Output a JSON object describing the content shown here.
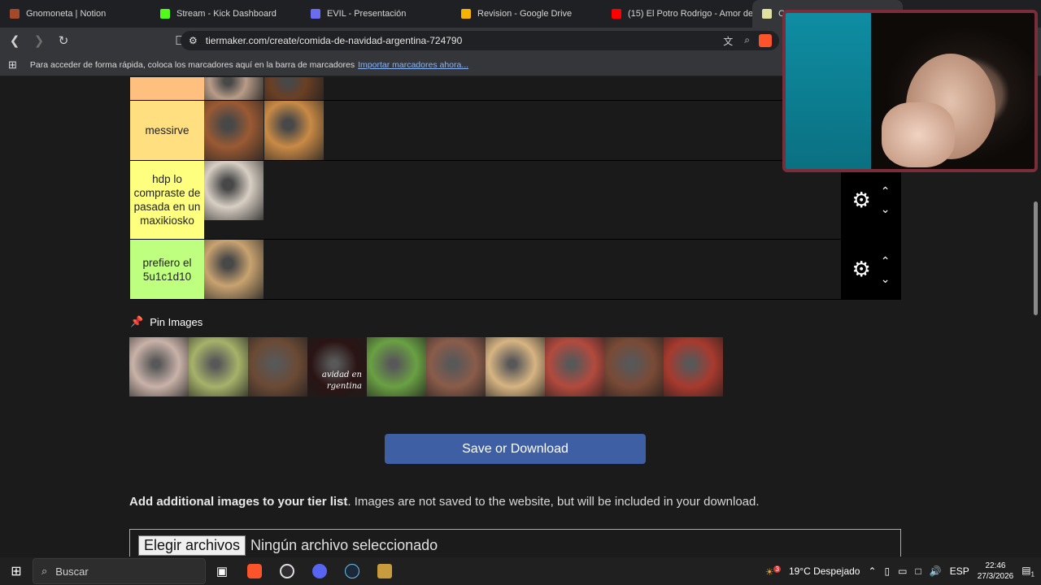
{
  "tabs": [
    {
      "label": "Gnomoneta | Notion",
      "color": "#a44a2a"
    },
    {
      "label": "Stream - Kick Dashboard",
      "color": "#53fc18"
    },
    {
      "label": "EVIL - Presentación",
      "color": "#6c6cf0"
    },
    {
      "label": "Revision - Google Drive",
      "color": "#f4b400"
    },
    {
      "label": "(15) El Potro Rodrigo - Amor de",
      "color": "#ff0000"
    },
    {
      "label": "Cr",
      "color": "#e0e0a0"
    }
  ],
  "address": {
    "url": "tiermaker.com/create/comida-de-navidad-argentina-724790"
  },
  "bookmarks": {
    "text": "Para acceder de forma rápida, coloca los marcadores aquí en la barra de marcadores",
    "link": "Importar marcadores ahora..."
  },
  "tiers": [
    {
      "label": "",
      "color": "#ffbf7f",
      "items": [
        {
          "color": "#b89c88"
        },
        {
          "color": "#6b3f23"
        }
      ]
    },
    {
      "label": "messirve",
      "color": "#ffdf7f",
      "items": [
        {
          "color": "#9a5a33"
        },
        {
          "color": "#c98a45"
        }
      ]
    },
    {
      "label": "hdp lo compraste de pasada en un maxikiosko",
      "color": "#ffff7f",
      "items": [
        {
          "color": "#d8cfc4"
        }
      ]
    },
    {
      "label": "prefiero el 5u1c1d10",
      "color": "#bfff7f",
      "items": [
        {
          "color": "#c9a370"
        }
      ]
    }
  ],
  "pin": {
    "title": "Pin Images",
    "items": [
      {
        "color": "#c9b2a8"
      },
      {
        "color": "#a6b26a"
      },
      {
        "color": "#6b4a35"
      },
      {
        "color": "#2a1414"
      },
      {
        "color": "#6aa043"
      },
      {
        "color": "#8a5c4a"
      },
      {
        "color": "#d7b482"
      },
      {
        "color": "#b34a3e"
      },
      {
        "color": "#7a4a36"
      },
      {
        "color": "#a83a2e"
      }
    ],
    "overlay_text": "avidad en rgentina"
  },
  "save_label": "Save or Download",
  "add": {
    "bold": "Add additional images to your tier list",
    "rest": ". Images are not saved to the website, but will be included in your download."
  },
  "file": {
    "button": "Elegir archivos",
    "status": "Ningún archivo seleccionado"
  },
  "taskbar": {
    "search_placeholder": "Buscar",
    "weather": "19°C  Despejado",
    "weather_badge": "3",
    "lang": "ESP",
    "time": "22:46",
    "date": "27/3/2026",
    "notifications": "1"
  }
}
